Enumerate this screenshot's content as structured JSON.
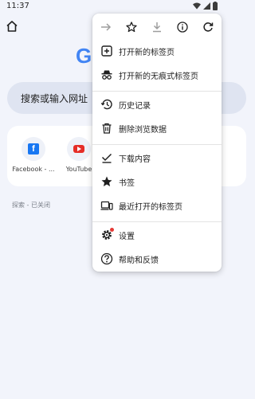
{
  "status_bar": {
    "time": "11:37",
    "icons": [
      "wifi-icon",
      "signal-icon",
      "battery-icon"
    ]
  },
  "home": {
    "logo_text": "G",
    "search_placeholder": "搜索或输入网址",
    "shortcuts": [
      {
        "label": "Facebook - ...",
        "icon": "facebook-icon"
      },
      {
        "label": "YouTube",
        "icon": "youtube-icon"
      }
    ],
    "discover_label": "探索 - 已关闭"
  },
  "menu": {
    "toolbar": [
      "forward-icon",
      "bookmark-star-icon",
      "download-icon",
      "info-icon",
      "refresh-icon"
    ],
    "items": [
      {
        "label": "打开新的标签页",
        "icon": "new-tab-icon"
      },
      {
        "label": "打开新的无痕式标签页",
        "icon": "incognito-icon"
      },
      {
        "label": "历史记录",
        "icon": "history-icon"
      },
      {
        "label": "删除浏览数据",
        "icon": "trash-icon"
      },
      {
        "label": "下载内容",
        "icon": "downloads-icon"
      },
      {
        "label": "书签",
        "icon": "bookmarks-icon"
      },
      {
        "label": "最近打开的标签页",
        "icon": "recent-tabs-icon"
      },
      {
        "label": "设置",
        "icon": "settings-icon"
      },
      {
        "label": "帮助和反馈",
        "icon": "help-icon"
      }
    ]
  },
  "colors": {
    "background": "#f2f4fb",
    "search_bg": "#dfe4f1",
    "menu_bg": "#ffffff",
    "google_blue": "#4285f4",
    "facebook_blue": "#1877f2",
    "youtube_red": "#e52d27",
    "settings_dot": "#e53935"
  }
}
